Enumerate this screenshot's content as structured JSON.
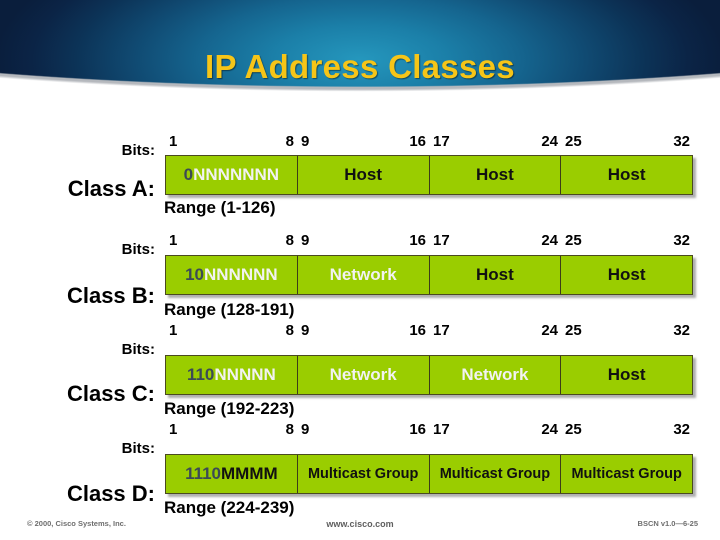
{
  "header": {
    "title": "IP Address Classes",
    "title_color": "#f6c518",
    "band_color_center": "#2597bd",
    "band_color_edge": "#0a1e3c"
  },
  "theme": {
    "bar_green": "#9acd00",
    "bar_border": "#4a4a20",
    "prefix_bit_color": "#3c4a55"
  },
  "labels": {
    "bits": "Bits:"
  },
  "classes": [
    {
      "name": "Class A:",
      "ticks": [
        {
          "start": "1",
          "end": "8"
        },
        {
          "start": "9",
          "end": "16"
        },
        {
          "start": "17",
          "end": "24"
        },
        {
          "start": "25",
          "end": "32"
        }
      ],
      "segments": [
        {
          "prefix": "0",
          "suffix": "NNNNNNN",
          "suffix_tone": "light"
        },
        {
          "text": "Host",
          "tone": "dark"
        },
        {
          "text": "Host",
          "tone": "dark"
        },
        {
          "text": "Host",
          "tone": "dark"
        }
      ],
      "range": "Range (1-126)"
    },
    {
      "name": "Class B:",
      "ticks": [
        {
          "start": "1",
          "end": "8"
        },
        {
          "start": "9",
          "end": "16"
        },
        {
          "start": "17",
          "end": "24"
        },
        {
          "start": "25",
          "end": "32"
        }
      ],
      "segments": [
        {
          "prefix": "10",
          "suffix": "NNNNNN",
          "suffix_tone": "light"
        },
        {
          "text": "Network",
          "tone": "light"
        },
        {
          "text": "Host",
          "tone": "dark"
        },
        {
          "text": "Host",
          "tone": "dark"
        }
      ],
      "range": "Range (128-191)"
    },
    {
      "name": "Class C:",
      "ticks": [
        {
          "start": "1",
          "end": "8"
        },
        {
          "start": "9",
          "end": "16"
        },
        {
          "start": "17",
          "end": "24"
        },
        {
          "start": "25",
          "end": "32"
        }
      ],
      "segments": [
        {
          "prefix": "110",
          "suffix": "NNNNN",
          "suffix_tone": "light"
        },
        {
          "text": "Network",
          "tone": "light"
        },
        {
          "text": "Network",
          "tone": "light"
        },
        {
          "text": "Host",
          "tone": "dark"
        }
      ],
      "range": "Range (192-223)"
    },
    {
      "name": "Class D:",
      "ticks": [
        {
          "start": "1",
          "end": "8"
        },
        {
          "start": "9",
          "end": "16"
        },
        {
          "start": "17",
          "end": "24"
        },
        {
          "start": "25",
          "end": "32"
        }
      ],
      "segments": [
        {
          "prefix": "1110",
          "suffix": "MMMM",
          "suffix_tone": "dark"
        },
        {
          "text": "Multicast Group",
          "tone": "dark",
          "small": true
        },
        {
          "text": "Multicast Group",
          "tone": "dark",
          "small": true
        },
        {
          "text": "Multicast Group",
          "tone": "dark",
          "small": true
        }
      ],
      "range": "Range (224-239)"
    }
  ],
  "footer": {
    "copyright": "© 2000, Cisco Systems, Inc.",
    "url": "www.cisco.com",
    "version": "BSCN v1.0—6-25"
  }
}
